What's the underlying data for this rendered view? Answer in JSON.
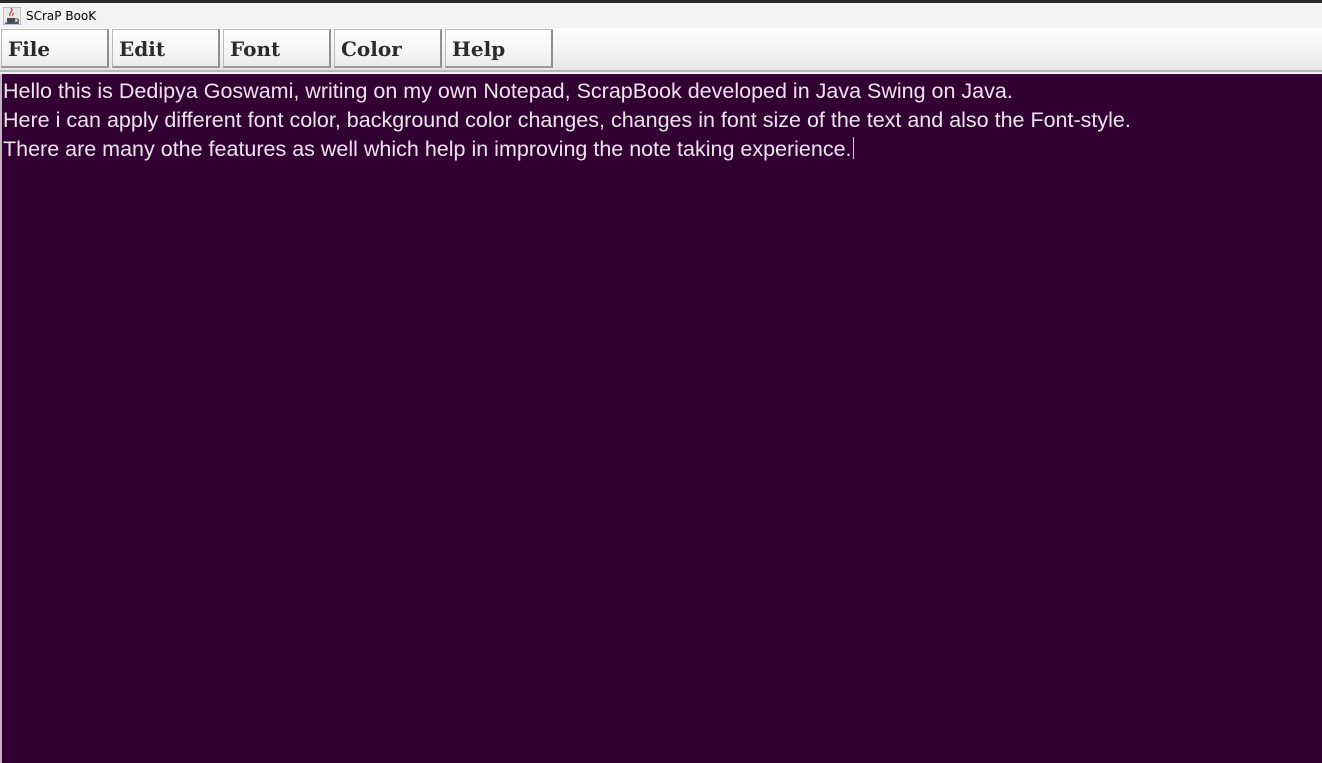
{
  "window": {
    "title": "SCraP BooK",
    "icon": "java-cup-icon"
  },
  "menubar": {
    "items": [
      {
        "label": "File"
      },
      {
        "label": "Edit"
      },
      {
        "label": "Font"
      },
      {
        "label": "Color"
      },
      {
        "label": "Help"
      }
    ]
  },
  "editor": {
    "background_color": "#330033",
    "text_color": "#ebe4eb",
    "lines": [
      "Hello this is Dedipya Goswami, writing on my own Notepad, ScrapBook developed in Java Swing on Java.",
      "Here i can apply different font color, background color changes, changes in font size of the text and also the Font-style.",
      "There are many othe features as well which help in improving the note taking experience."
    ]
  }
}
